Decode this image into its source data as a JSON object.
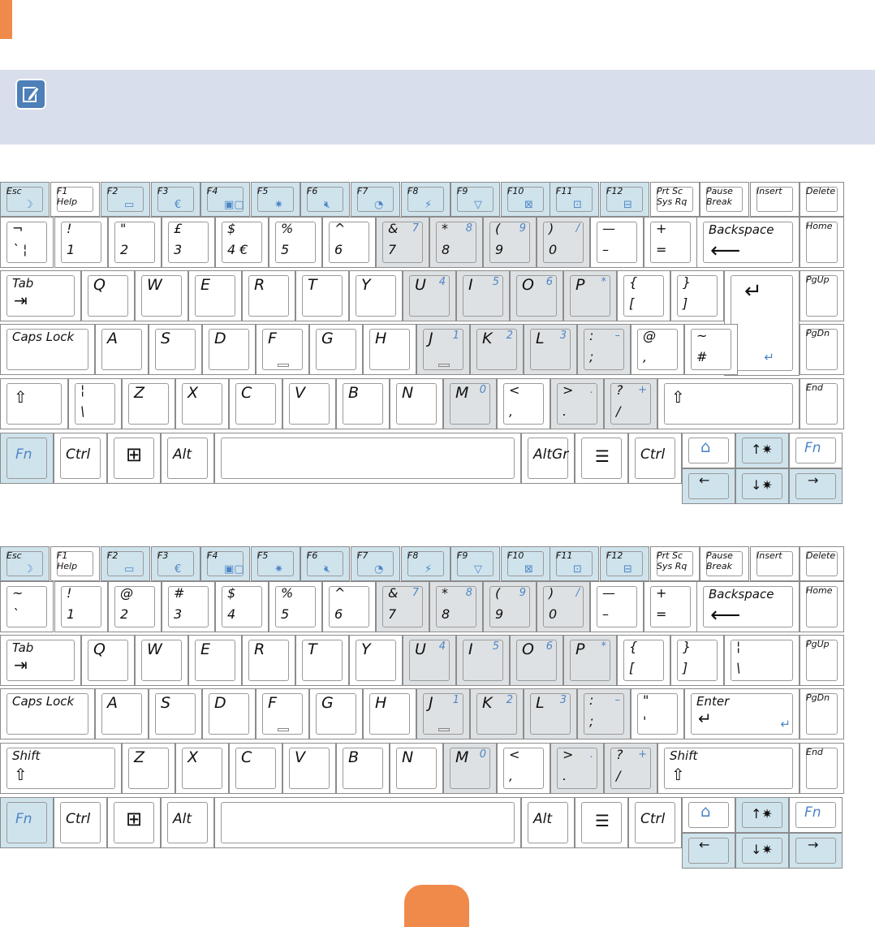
{
  "colors": {
    "accent": "#f08a4b",
    "note_bg": "#d8deeb",
    "fn_key": "#cfe3ec",
    "numpad_key": "#dee1e3",
    "fn_text": "#4d86c6"
  },
  "note": {
    "icon": "pencil-note-icon"
  },
  "keyboards": [
    {
      "id": "kb1",
      "function_row": [
        {
          "label": "Esc",
          "icon": "moon-icon",
          "fn": true
        },
        {
          "label": "F1",
          "sub": "Help",
          "fn": false
        },
        {
          "label": "F2",
          "icon": "battery-icon",
          "fn": true
        },
        {
          "label": "F3",
          "icon": "euro-icon",
          "fn": true
        },
        {
          "label": "F4",
          "icon": "display-switch-icon",
          "fn": true
        },
        {
          "label": "F5",
          "icon": "brightness-icon",
          "fn": true
        },
        {
          "label": "F6",
          "icon": "mute-icon",
          "fn": true
        },
        {
          "label": "F7",
          "icon": "play-icon",
          "fn": true
        },
        {
          "label": "F8",
          "icon": "runner-icon",
          "fn": true
        },
        {
          "label": "F9",
          "icon": "wireless-icon",
          "fn": true
        },
        {
          "label": "F10",
          "icon": "touchpad-icon",
          "fn": true
        },
        {
          "label": "F11",
          "icon": "num-lock-icon",
          "fn": true
        },
        {
          "label": "F12",
          "icon": "scroll-lock-icon",
          "fn": true
        },
        {
          "label": "Prt Sc",
          "sub": "Sys Rq",
          "fn": false
        },
        {
          "label": "Pause",
          "sub": "Break",
          "fn": false
        },
        {
          "label": "Insert",
          "fn": false
        },
        {
          "label": "Delete",
          "fn": false
        }
      ],
      "number_row": [
        {
          "top": "¬",
          "bottom": "`  ¦"
        },
        {
          "top": "!",
          "bottom": "1"
        },
        {
          "top": "\"",
          "bottom": "2"
        },
        {
          "top": "£",
          "bottom": "3"
        },
        {
          "top": "$",
          "bottom": "4  €"
        },
        {
          "top": "%",
          "bottom": "5"
        },
        {
          "top": "^",
          "bottom": "6"
        },
        {
          "top": "&",
          "bottom": "7",
          "num": "7"
        },
        {
          "top": "*",
          "bottom": "8",
          "num": "8"
        },
        {
          "top": "(",
          "bottom": "9",
          "num": "9"
        },
        {
          "top": ")",
          "bottom": "0",
          "num": "/"
        },
        {
          "top": "—",
          "bottom": "–"
        },
        {
          "top": "+",
          "bottom": "="
        },
        {
          "label": "Backspace"
        },
        {
          "label": "Home"
        }
      ],
      "qwerty_row": [
        {
          "label": "Tab"
        },
        {
          "main": "Q"
        },
        {
          "main": "W"
        },
        {
          "main": "E"
        },
        {
          "main": "R"
        },
        {
          "main": "T"
        },
        {
          "main": "Y"
        },
        {
          "main": "U",
          "num": "4"
        },
        {
          "main": "I",
          "num": "5"
        },
        {
          "main": "O",
          "num": "6"
        },
        {
          "main": "P",
          "num": "*"
        },
        {
          "top": "{",
          "bottom": "["
        },
        {
          "top": "}",
          "bottom": "]"
        },
        {
          "label": ""
        },
        {
          "label": "PgUp"
        }
      ],
      "home_row": [
        {
          "label": "Caps Lock"
        },
        {
          "main": "A"
        },
        {
          "main": "S"
        },
        {
          "main": "D"
        },
        {
          "main": "F"
        },
        {
          "main": "G"
        },
        {
          "main": "H"
        },
        {
          "main": "J",
          "num": "1"
        },
        {
          "main": "K",
          "num": "2"
        },
        {
          "main": "L",
          "num": "3"
        },
        {
          "top": ":",
          "bottom": ";",
          "num": "–"
        },
        {
          "top": "@",
          "bottom": ","
        },
        {
          "top": "~",
          "bottom": "#"
        },
        {
          "label": "PgDn"
        }
      ],
      "shift_row": [
        {
          "label": ""
        },
        {
          "top": "¦",
          "bottom": "\\"
        },
        {
          "main": "Z"
        },
        {
          "main": "X"
        },
        {
          "main": "C"
        },
        {
          "main": "V"
        },
        {
          "main": "B"
        },
        {
          "main": "N"
        },
        {
          "main": "M",
          "num": "0"
        },
        {
          "top": "<",
          "bottom": ","
        },
        {
          "top": ">",
          "bottom": ".",
          "num": "."
        },
        {
          "top": "?",
          "bottom": "/",
          "num": "+"
        },
        {
          "label": ""
        },
        {
          "label": "End"
        }
      ],
      "bottom_row": {
        "fn": "Fn",
        "ctrl": "Ctrl",
        "alt": "Alt",
        "altgr": "AltGr",
        "ctrl2": "Ctrl",
        "fn2": "Fn"
      }
    },
    {
      "id": "kb2",
      "function_row": [
        {
          "label": "Esc",
          "icon": "moon-icon",
          "fn": true
        },
        {
          "label": "F1",
          "sub": "Help",
          "fn": false
        },
        {
          "label": "F2",
          "icon": "battery-icon",
          "fn": true
        },
        {
          "label": "F3",
          "icon": "euro-icon",
          "fn": true
        },
        {
          "label": "F4",
          "icon": "display-switch-icon",
          "fn": true
        },
        {
          "label": "F5",
          "icon": "brightness-icon",
          "fn": true
        },
        {
          "label": "F6",
          "icon": "mute-icon",
          "fn": true
        },
        {
          "label": "F7",
          "icon": "play-icon",
          "fn": true
        },
        {
          "label": "F8",
          "icon": "runner-icon",
          "fn": true
        },
        {
          "label": "F9",
          "icon": "wireless-icon",
          "fn": true
        },
        {
          "label": "F10",
          "icon": "touchpad-icon",
          "fn": true
        },
        {
          "label": "F11",
          "icon": "num-lock-icon",
          "fn": true
        },
        {
          "label": "F12",
          "icon": "scroll-lock-icon",
          "fn": true
        },
        {
          "label": "Prt Sc",
          "sub": "Sys Rq",
          "fn": false
        },
        {
          "label": "Pause",
          "sub": "Break",
          "fn": false
        },
        {
          "label": "Insert",
          "fn": false
        },
        {
          "label": "Delete",
          "fn": false
        }
      ],
      "number_row": [
        {
          "top": "~",
          "bottom": "`"
        },
        {
          "top": "!",
          "bottom": "1"
        },
        {
          "top": "@",
          "bottom": "2"
        },
        {
          "top": "#",
          "bottom": "3"
        },
        {
          "top": "$",
          "bottom": "4"
        },
        {
          "top": "%",
          "bottom": "5"
        },
        {
          "top": "^",
          "bottom": "6"
        },
        {
          "top": "&",
          "bottom": "7",
          "num": "7"
        },
        {
          "top": "*",
          "bottom": "8",
          "num": "8"
        },
        {
          "top": "(",
          "bottom": "9",
          "num": "9"
        },
        {
          "top": ")",
          "bottom": "0",
          "num": "/"
        },
        {
          "top": "—",
          "bottom": "–"
        },
        {
          "top": "+",
          "bottom": "="
        },
        {
          "label": "Backspace"
        },
        {
          "label": "Home"
        }
      ],
      "qwerty_row": [
        {
          "label": "Tab"
        },
        {
          "main": "Q"
        },
        {
          "main": "W"
        },
        {
          "main": "E"
        },
        {
          "main": "R"
        },
        {
          "main": "T"
        },
        {
          "main": "Y"
        },
        {
          "main": "U",
          "num": "4"
        },
        {
          "main": "I",
          "num": "5"
        },
        {
          "main": "O",
          "num": "6"
        },
        {
          "main": "P",
          "num": "*"
        },
        {
          "top": "{",
          "bottom": "["
        },
        {
          "top": "}",
          "bottom": "]"
        },
        {
          "top": "¦",
          "bottom": "\\"
        },
        {
          "label": "PgUp"
        }
      ],
      "home_row": [
        {
          "label": "Caps Lock"
        },
        {
          "main": "A"
        },
        {
          "main": "S"
        },
        {
          "main": "D"
        },
        {
          "main": "F"
        },
        {
          "main": "G"
        },
        {
          "main": "H"
        },
        {
          "main": "J",
          "num": "1"
        },
        {
          "main": "K",
          "num": "2"
        },
        {
          "main": "L",
          "num": "3"
        },
        {
          "top": ":",
          "bottom": ";",
          "num": "–"
        },
        {
          "top": "\"",
          "bottom": "'"
        },
        {
          "label": "Enter"
        },
        {
          "label": "PgDn"
        }
      ],
      "shift_row": [
        {
          "label": "Shift"
        },
        {
          "main": "Z"
        },
        {
          "main": "X"
        },
        {
          "main": "C"
        },
        {
          "main": "V"
        },
        {
          "main": "B"
        },
        {
          "main": "N"
        },
        {
          "main": "M",
          "num": "0"
        },
        {
          "top": "<",
          "bottom": ","
        },
        {
          "top": ">",
          "bottom": ".",
          "num": "."
        },
        {
          "top": "?",
          "bottom": "/",
          "num": "+"
        },
        {
          "label": "Shift"
        },
        {
          "label": "End"
        }
      ],
      "bottom_row": {
        "fn": "Fn",
        "ctrl": "Ctrl",
        "alt": "Alt",
        "altgr": "Alt",
        "ctrl2": "Ctrl",
        "fn2": "Fn"
      }
    }
  ]
}
